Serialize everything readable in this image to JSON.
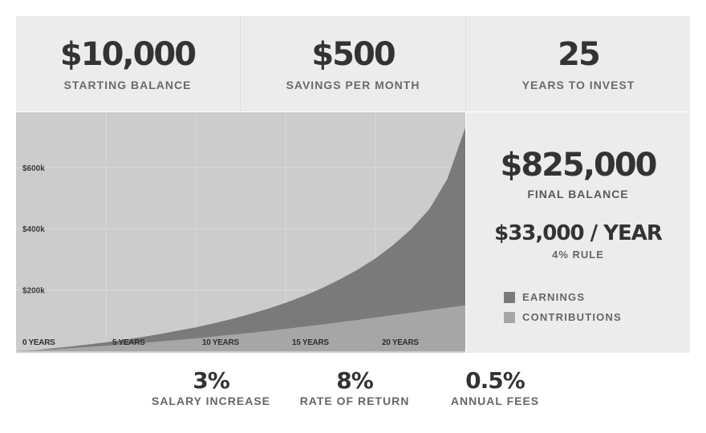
{
  "top_stats": {
    "starting_balance": {
      "value": "$10,000",
      "label": "STARTING BALANCE"
    },
    "savings_per_month": {
      "value": "$500",
      "label": "SAVINGS PER MONTH"
    },
    "years_to_invest": {
      "value": "25",
      "label": "YEARS TO INVEST"
    }
  },
  "result": {
    "final_balance": "$825,000",
    "final_label": "FINAL BALANCE",
    "yearly": "$33,000 / YEAR",
    "rule_label": "4% RULE",
    "legend": [
      {
        "label": "EARNINGS",
        "color": "#7a7a7a"
      },
      {
        "label": "CONTRIBUTIONS",
        "color": "#a6a6a6"
      }
    ]
  },
  "bottom_stats": [
    {
      "value": "3%",
      "label": "SALARY INCREASE"
    },
    {
      "value": "8%",
      "label": "RATE OF RETURN"
    },
    {
      "value": "0.5%",
      "label": "ANNUAL FEES"
    }
  ],
  "colors": {
    "panel_bg": "#ececec",
    "chart_bg": "#cccccc",
    "earnings": "#7a7a7a",
    "contributions": "#a6a6a6",
    "text_dark": "#333333",
    "text_muted": "#666666"
  },
  "chart_data": {
    "type": "area",
    "x": [
      0,
      1,
      2,
      3,
      4,
      5,
      6,
      7,
      8,
      9,
      10,
      11,
      12,
      13,
      14,
      15,
      16,
      17,
      18,
      19,
      20,
      21,
      22,
      23,
      24,
      25
    ],
    "x_ticks": [
      0,
      5,
      10,
      15,
      20
    ],
    "x_tick_labels": [
      "0 YEARS",
      "5 YEARS",
      "10 YEARS",
      "15 YEARS",
      "20 YEARS"
    ],
    "y_ticks": [
      200000,
      400000,
      600000
    ],
    "y_tick_labels": [
      "$200k",
      "$400k",
      "$600k"
    ],
    "xlim": [
      0,
      25
    ],
    "ylim": [
      0,
      780000
    ],
    "stacked": true,
    "series": [
      {
        "name": "CONTRIBUTIONS",
        "values": [
          0,
          2000,
          6000,
          10000,
          14000,
          18000,
          22000,
          27000,
          32000,
          37000,
          42000,
          48000,
          54000,
          60000,
          66000,
          73000,
          80000,
          87000,
          95000,
          102000,
          110000,
          118000,
          126000,
          134000,
          142000,
          150000
        ]
      },
      {
        "name": "EARNINGS",
        "values": [
          0,
          1000,
          3000,
          5000,
          8000,
          11000,
          15000,
          19000,
          24000,
          30000,
          36000,
          43000,
          51000,
          61000,
          72000,
          85000,
          100000,
          118000,
          139000,
          164000,
          193000,
          229000,
          273000,
          330000,
          420000,
          580000
        ]
      }
    ],
    "grid": true,
    "legend": "right"
  }
}
